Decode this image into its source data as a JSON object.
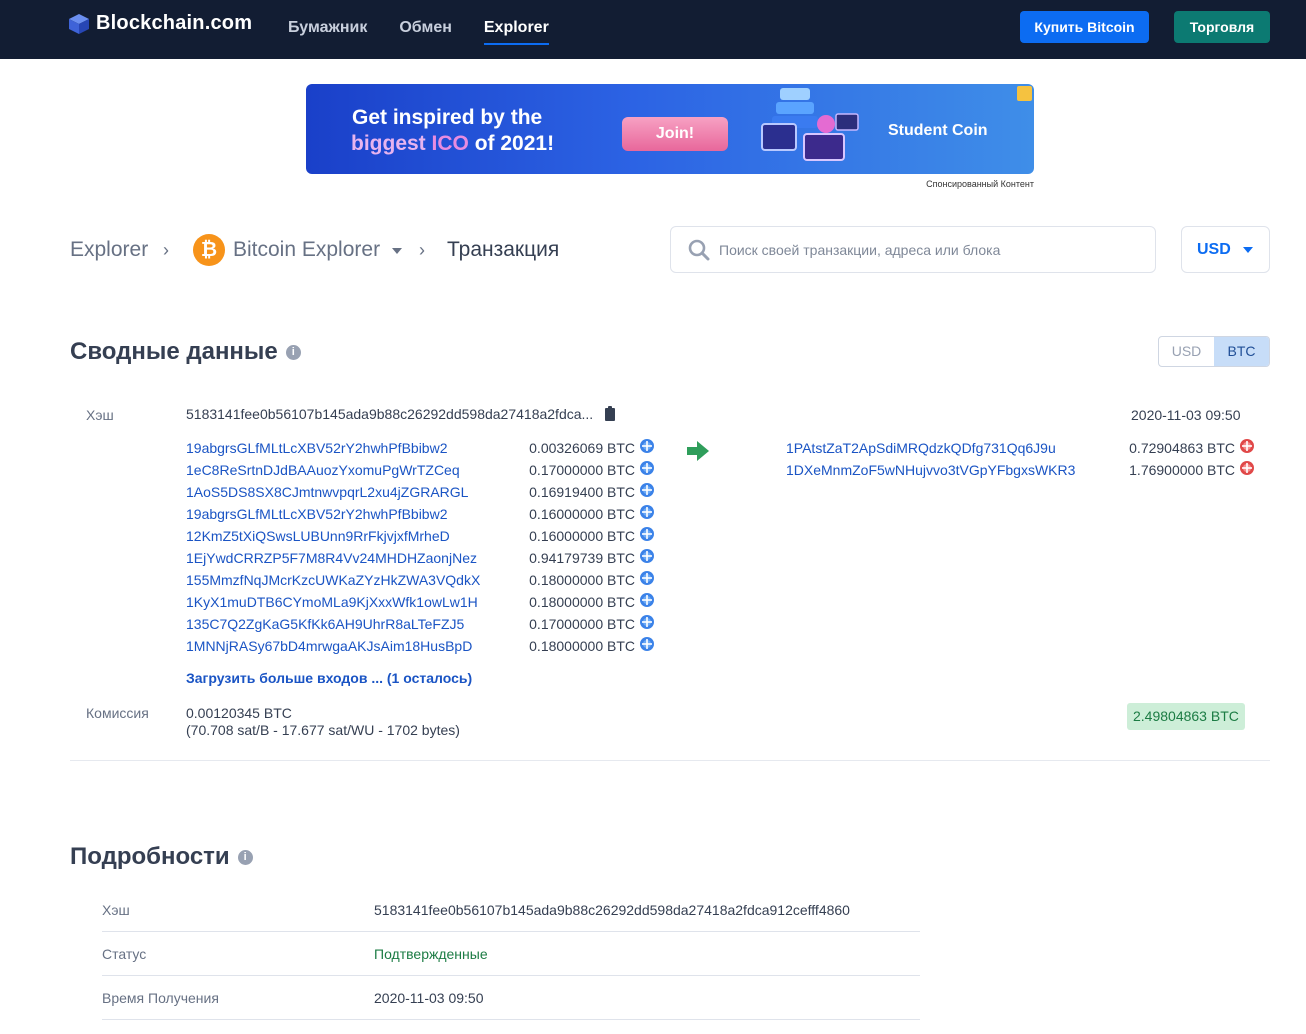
{
  "header": {
    "logo_text": "Blockchain.com",
    "nav": [
      "Бумажник",
      "Обмен",
      "Explorer"
    ],
    "buy_button": "Купить Bitcoin",
    "trade_button": "Торговля"
  },
  "ad": {
    "line1": "Get inspired by the",
    "line2_part1": "biggest ",
    "line2_part2": "ICO",
    "line2_part3": " of 2021!",
    "cta": "Join!",
    "brand": "Student Coin",
    "sponsored": "Спонсированный Контент"
  },
  "breadcrumb": {
    "root": "Explorer",
    "explorer": "Bitcoin Explorer",
    "btc_symbol": "₿",
    "current": "Транзакция"
  },
  "search": {
    "placeholder": "Поиск своей транзакции, адреса или блока"
  },
  "currency": "USD",
  "summary": {
    "title": "Сводные данные",
    "toggle": [
      "USD",
      "BTC"
    ],
    "hash_label": "Хэш",
    "hash": "5183141fee0b56107b145ada9b88c26292dd598da27418a2fdca...",
    "timestamp": "2020-11-03 09:50",
    "inputs": [
      {
        "address": "19abgrsGLfMLtLcXBV52rY2hwhPfBbibw2",
        "amount": "0.00326069 BTC"
      },
      {
        "address": "1eC8ReSrtnDJdBAAuozYxomuPgWrTZCeq",
        "amount": "0.17000000 BTC"
      },
      {
        "address": "1AoS5DS8SX8CJmtnwvpqrL2xu4jZGRARGL",
        "amount": "0.16919400 BTC"
      },
      {
        "address": "19abgrsGLfMLtLcXBV52rY2hwhPfBbibw2",
        "amount": "0.16000000 BTC"
      },
      {
        "address": "12KmZ5tXiQSwsLUBUnn9RrFkjvjxfMrheD",
        "amount": "0.16000000 BTC"
      },
      {
        "address": "1EjYwdCRRZP5F7M8R4Vv24MHDHZaonjNez",
        "amount": "0.94179739 BTC"
      },
      {
        "address": "155MmzfNqJMcrKzcUWKaZYzHkZWA3VQdkX",
        "amount": "0.18000000 BTC"
      },
      {
        "address": "1KyX1muDTB6CYmoMLa9KjXxxWfk1owLw1H",
        "amount": "0.18000000 BTC"
      },
      {
        "address": "135C7Q2ZgKaG5KfKk6AH9UhrR8aLTeFZJ5",
        "amount": "0.17000000 BTC"
      },
      {
        "address": "1MNNjRASy67bD4mrwgaAKJsAim18HusBpD",
        "amount": "0.18000000 BTC"
      }
    ],
    "outputs": [
      {
        "address": "1PAtstZaT2ApSdiMRQdzkQDfg731Qq6J9u",
        "amount": "0.72904863 BTC"
      },
      {
        "address": "1DXeMnmZoF5wNHujvvo3tVGpYFbgxsWKR3",
        "amount": "1.76900000 BTC"
      }
    ],
    "load_more": "Загрузить больше входов ... (1 осталось)",
    "fee_label": "Комиссия",
    "fee": "0.00120345 BTC",
    "fee_detail": "(70.708 sat/B - 17.677 sat/WU - 1702 bytes)",
    "total": "2.49804863 BTC"
  },
  "details": {
    "title": "Подробности",
    "rows": [
      {
        "key": "Хэш",
        "value": "5183141fee0b56107b145ada9b88c26292dd598da27418a2fdca912cefff4860"
      },
      {
        "key": "Статус",
        "value": "Подтвержденные"
      },
      {
        "key": "Время Получения",
        "value": "2020-11-03 09:50"
      }
    ]
  },
  "colors": {
    "header_bg": "#121d33",
    "primary": "#0c6cf2",
    "trade": "#0c7a72",
    "confirmed_green": "#1c7c44",
    "link": "#1a54c4"
  }
}
